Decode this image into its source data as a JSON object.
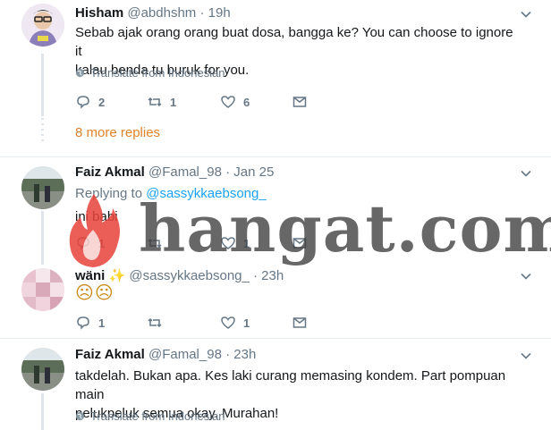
{
  "tweets": [
    {
      "name": "Hisham",
      "handle": "@abdhshm",
      "time": "· 19h",
      "text_line1": "Sebab ajak orang orang buat dosa, bangga ke? You can choose to ignore it",
      "text_line2": "kalau benda tu buruk for you.",
      "translate": "Translate from Indonesian",
      "reply_count": "2",
      "retweet_count": "1",
      "like_count": "6"
    },
    {
      "name": "Faiz Akmal",
      "handle": "@Famal_98",
      "time": "· Jan 25",
      "replying_prefix": "Replying to",
      "replying_to": "@sassykkaebsong_",
      "text": "ini babi",
      "reply_count": "1",
      "retweet_count": "",
      "like_count": "1"
    },
    {
      "name": "wäni",
      "handle": "@sassykkaebsong_",
      "time": "· 23h",
      "text": "☹☹",
      "reply_count": "1",
      "retweet_count": "",
      "like_count": "1"
    },
    {
      "name": "Faiz Akmal",
      "handle": "@Famal_98",
      "time": "· 23h",
      "text_line1": "takdelah. Bukan apa. Kes laki curang memasing kondem. Part pompuan main",
      "text_line2": "pelukpeluk semua okay. Murahan!",
      "translate": "Translate from Indonesian"
    }
  ],
  "more_replies": "8 more replies",
  "watermark": "hangat.com",
  "colors": {
    "accent": "#1da1f2",
    "more_replies": "#e0822b",
    "muted": "#657786",
    "flame": "#e8433a"
  },
  "icons": [
    "chevron-down-icon",
    "reply-icon",
    "retweet-icon",
    "heart-icon",
    "message-icon",
    "globe-icon",
    "sparkle-icon",
    "frown-emoji",
    "flame-icon"
  ]
}
